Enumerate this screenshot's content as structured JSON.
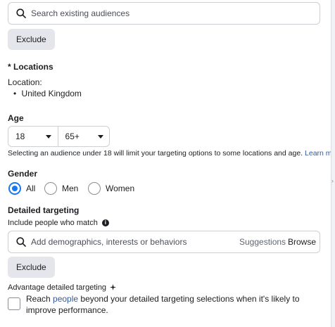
{
  "audiences": {
    "search_placeholder": "Search existing audiences",
    "exclude_label": "Exclude"
  },
  "locations": {
    "heading": "* Locations",
    "location_label": "Location:",
    "items": [
      "United Kingdom"
    ]
  },
  "age": {
    "heading": "Age",
    "min": "18",
    "max": "65+",
    "note": "Selecting an audience under 18 will limit your targeting options to some locations and age.",
    "learn_more": "Learn more"
  },
  "gender": {
    "heading": "Gender",
    "options": [
      "All",
      "Men",
      "Women"
    ],
    "selected": "All"
  },
  "detailed_targeting": {
    "heading": "Detailed targeting",
    "include_label": "Include people who match",
    "search_placeholder": "Add demographics, interests or behaviors",
    "suggestions_label": "Suggestions",
    "browse_label": "Browse",
    "exclude_label": "Exclude"
  },
  "advantage": {
    "heading": "Advantage detailed targeting",
    "reach_before": "Reach ",
    "reach_link": "people",
    "reach_after": " beyond your detailed targeting selections when it's likely to improve performance.",
    "checked": false
  },
  "colors": {
    "accent": "#1877f2",
    "link": "#385898",
    "button_bg": "#e4e6eb",
    "border": "#ccd0d5"
  }
}
